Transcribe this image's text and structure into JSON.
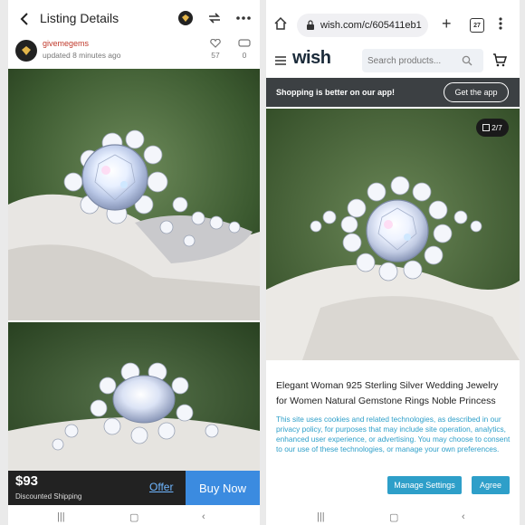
{
  "left_app": {
    "header": {
      "title": "Listing Details"
    },
    "seller": {
      "name": "givemegems",
      "updated": "updated 8 minutes ago",
      "likes": "57",
      "comments": "0"
    },
    "buy_bar": {
      "price": "$93",
      "shipping": "Discounted Shipping",
      "offer_label": "Offer",
      "buy_now_label": "Buy Now"
    }
  },
  "right_browser": {
    "url": "wish.com/c/605411eb1",
    "tab_count": "27",
    "site": {
      "logo": "wish",
      "search_placeholder": "Search products..."
    },
    "promo": {
      "text": "Shopping is better on our app!",
      "button": "Get the app"
    },
    "image_counter": "2/7",
    "product_title": "Elegant Woman 925 Sterling Silver Wedding Jewelry for Women Natural Gemstone Rings Noble Princess",
    "consent": {
      "text": "This site uses cookies and related technologies, as described in our privacy policy, for purposes that may include site operation, analytics, enhanced user experience, or advertising. You may choose to consent to our use of these technologies, or manage your own preferences.",
      "manage_label": "Manage Settings",
      "agree_label": "Agree"
    }
  },
  "colors": {
    "buy_now": "#3b8be0",
    "wish_blue": "#2e9fc9",
    "promo_bar": "#3c4043"
  }
}
